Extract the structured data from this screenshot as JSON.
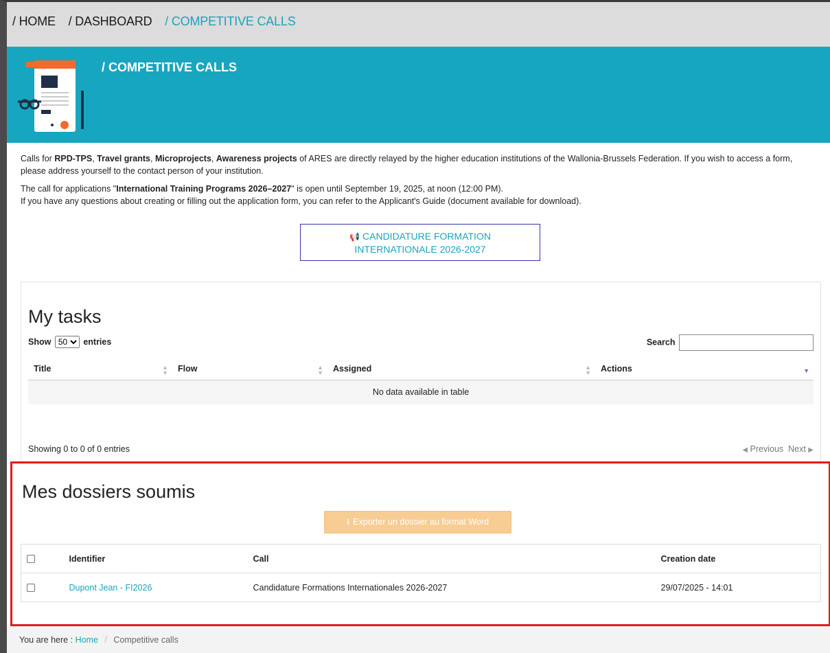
{
  "breadcrumb": {
    "home": "/ HOME",
    "dashboard": "/ DASHBOARD",
    "current": "/ COMPETITIVE CALLS"
  },
  "banner": {
    "title": "/ COMPETITIVE CALLS"
  },
  "intro": {
    "p1_a": "Calls for ",
    "p1_b1": "RPD-TPS",
    "p1_sep1": ", ",
    "p1_b2": "Travel grants",
    "p1_sep2": ", ",
    "p1_b3": "Microprojects",
    "p1_sep3": ", ",
    "p1_b4": "Awareness projects",
    "p1_rest": " of ARES are directly relayed by the higher education institutions of the Wallonia-Brussels Federation. If you wish to access a form, please address yourself to the contact person of your institution.",
    "p2_a": "The call for applications \"",
    "p2_b": "International Training Programs 2026–2027",
    "p2_c": "\" is open until September 19, 2025, at noon (12:00 PM).",
    "p3": "If you have any questions about creating or filling out the application form, you can refer to the Applicant's Guide (document available for download)."
  },
  "cta": {
    "line1": "CANDIDATURE FORMATION",
    "line2": "INTERNATIONALE 2026-2027"
  },
  "tasks": {
    "heading": "My tasks",
    "show_label": "Show",
    "entries_label": "entries",
    "page_size": "50",
    "search_label": "Search",
    "columns": [
      "Title",
      "Flow",
      "Assigned",
      "Actions"
    ],
    "empty": "No data available in table",
    "info": "Showing 0 to 0 of 0 entries",
    "prev": "Previous",
    "next": "Next"
  },
  "submitted": {
    "heading": "Mes dossiers soumis",
    "export_label": "Exporter un dossier au format Word",
    "columns": [
      "Identifier",
      "Call",
      "Creation date"
    ],
    "rows": [
      {
        "identifier": "Dupont Jean - FI2026",
        "call": "Candidature Formations Internationales 2026-2027",
        "date": "29/07/2025 - 14:01"
      }
    ]
  },
  "footer": {
    "prefix": "You are here :",
    "home": "Home",
    "sep": "/",
    "current": "Competitive calls"
  },
  "colors": {
    "accent": "#17a6c0",
    "highlight": "#e21b1b",
    "export_bg": "#f7cd93"
  }
}
